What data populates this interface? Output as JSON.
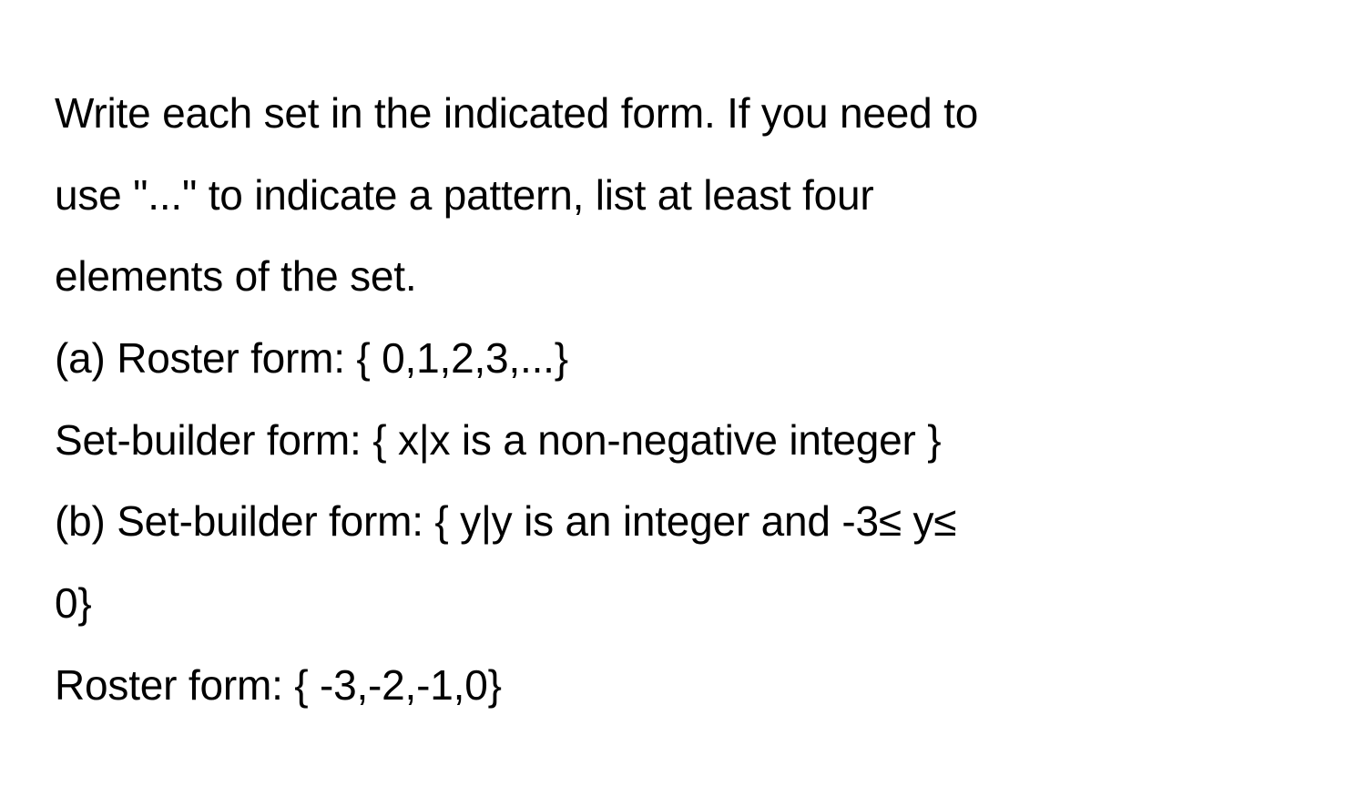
{
  "lines": {
    "l1": "Write each set in the indicated form. If you need to",
    "l2": "use \"...\" to indicate a pattern, list at least four",
    "l3": "elements of the set.",
    "l4": "(a) Roster form: { 0,1,2,3,...}",
    "l5": "Set-builder form: { x|x is a non-negative integer }",
    "l6": "(b) Set-builder form: { y|y is an integer and -3≤ y≤",
    "l7": "0}",
    "l8": "Roster form: { -3,-2,-1,0}"
  }
}
